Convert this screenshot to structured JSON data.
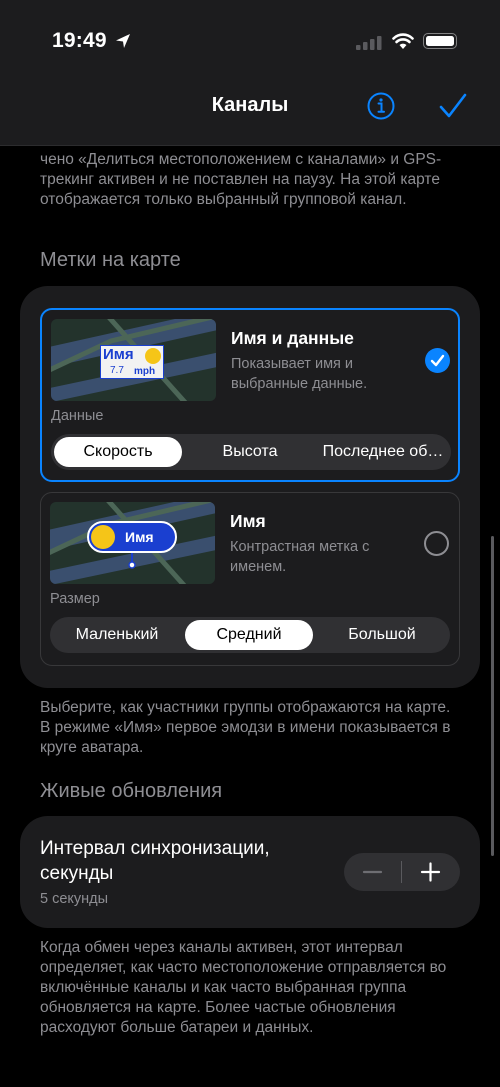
{
  "status_bar": {
    "time": "19:49"
  },
  "nav": {
    "title": "Каналы"
  },
  "top_note": {
    "partial": "чено «Делиться местоположением с каналами» и GPS-трекинг активен и не поставлен на паузу. На этой карте отображается только выбранный групповой канал."
  },
  "map_labels": {
    "header": "Метки на карте",
    "option_name_data": {
      "title": "Имя и данные",
      "description": "Показывает имя и выбранные данные.",
      "thumb_name": "Имя",
      "thumb_value": "7.7",
      "thumb_unit": "mph",
      "selected": true,
      "segment_label": "Данные",
      "segments": [
        "Скорость",
        "Высота",
        "Последнее об…"
      ],
      "active_segment": "Скорость"
    },
    "option_name": {
      "title": "Имя",
      "description": "Контрастная метка с именем.",
      "thumb_name": "Имя",
      "selected": false,
      "segment_label": "Размер",
      "segments": [
        "Маленький",
        "Средний",
        "Большой"
      ],
      "active_segment": "Средний"
    },
    "footer": "Выберите, как участники группы отображаются на карте. В режиме «Имя» первое эмодзи в имени показывается в круге аватара."
  },
  "live_updates": {
    "header": "Живые обновления",
    "title": "Интервал синхронизации, секунды",
    "value": "5 секунды",
    "footer": "Когда обмен через каналы активен, этот интервал определяет, как часто местоположение отправля­ется во включённые каналы и как часто выбранная группа обновляется на карте. Более частые обновления расходуют больше батареи и данных."
  },
  "colors": {
    "accent": "#0a84ff",
    "card": "#1c1c1e",
    "secondary_text": "#8e8e93"
  },
  "icons": [
    "location-arrow-icon",
    "signal-icon",
    "wifi-icon",
    "battery-icon",
    "info-icon",
    "checkmark-icon",
    "minus-icon",
    "plus-icon"
  ]
}
